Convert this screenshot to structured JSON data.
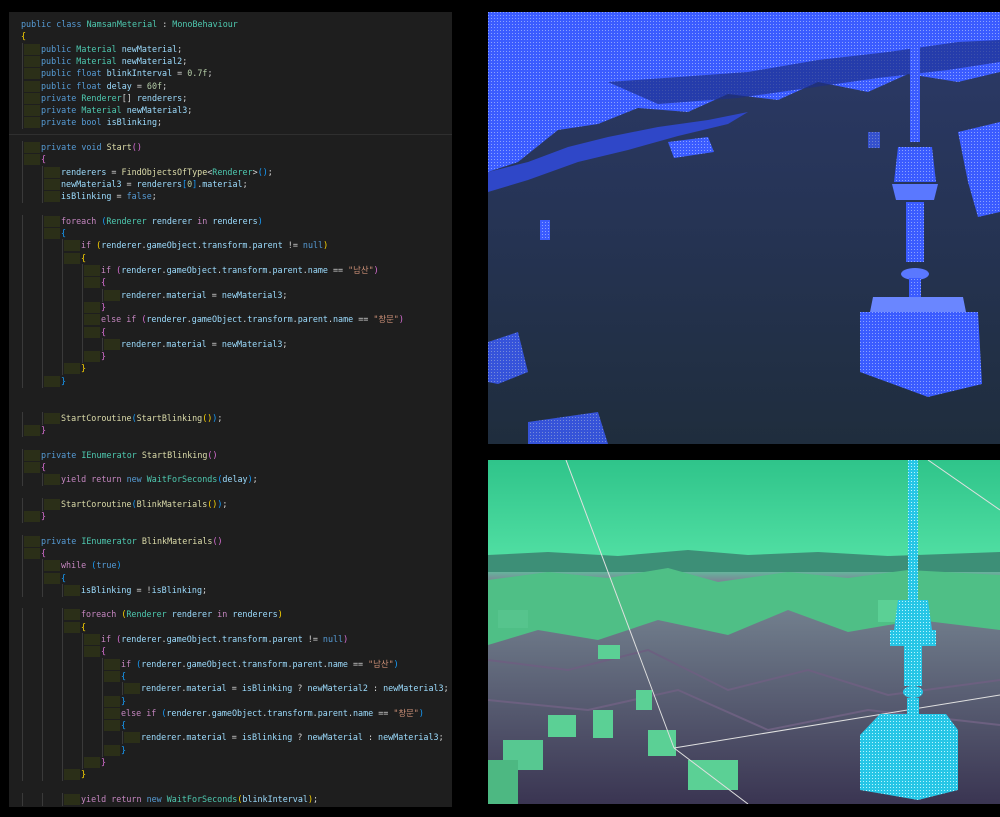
{
  "editor": {
    "lines": [
      {
        "i": 0,
        "t": [
          [
            "kw",
            "public "
          ],
          [
            "kw",
            "class "
          ],
          [
            "type",
            "NamsanMeterial"
          ],
          [
            "p",
            " : "
          ],
          [
            "type",
            "MonoBehaviour"
          ]
        ]
      },
      {
        "i": 0,
        "t": [
          [
            "br1",
            "{"
          ]
        ]
      },
      {
        "i": 1,
        "t": [
          [
            "kw",
            "public "
          ],
          [
            "type",
            "Material "
          ],
          [
            "var",
            "newMaterial"
          ],
          [
            "p",
            ";"
          ]
        ]
      },
      {
        "i": 1,
        "t": [
          [
            "kw",
            "public "
          ],
          [
            "type",
            "Material "
          ],
          [
            "var",
            "newMaterial2"
          ],
          [
            "p",
            ";"
          ]
        ]
      },
      {
        "i": 1,
        "t": [
          [
            "kw",
            "public "
          ],
          [
            "kw",
            "float "
          ],
          [
            "var",
            "blinkInterval"
          ],
          [
            "p",
            " = "
          ],
          [
            "num",
            "0.7f"
          ],
          [
            "p",
            ";"
          ]
        ]
      },
      {
        "i": 1,
        "t": [
          [
            "kw",
            "public "
          ],
          [
            "kw",
            "float "
          ],
          [
            "var",
            "delay"
          ],
          [
            "p",
            " = "
          ],
          [
            "num",
            "60f"
          ],
          [
            "p",
            ";"
          ]
        ]
      },
      {
        "i": 1,
        "t": [
          [
            "kw",
            "private "
          ],
          [
            "type",
            "Renderer"
          ],
          [
            "p",
            "[] "
          ],
          [
            "var",
            "renderers"
          ],
          [
            "p",
            ";"
          ]
        ]
      },
      {
        "i": 1,
        "t": [
          [
            "kw",
            "private "
          ],
          [
            "type",
            "Material "
          ],
          [
            "var",
            "newMaterial3"
          ],
          [
            "p",
            ";"
          ]
        ]
      },
      {
        "i": 1,
        "t": [
          [
            "kw",
            "private "
          ],
          [
            "kw",
            "bool "
          ],
          [
            "var",
            "isBlinking"
          ],
          [
            "p",
            ";"
          ]
        ]
      },
      {
        "i": 0,
        "t": []
      },
      {
        "i": 1,
        "t": [
          [
            "kw",
            "private "
          ],
          [
            "kw",
            "void "
          ],
          [
            "fn",
            "Start"
          ],
          [
            "br2",
            "()"
          ]
        ]
      },
      {
        "i": 1,
        "t": [
          [
            "br2",
            "{"
          ]
        ]
      },
      {
        "i": 2,
        "t": [
          [
            "var",
            "renderers"
          ],
          [
            "p",
            " = "
          ],
          [
            "fn",
            "FindObjectsOfType"
          ],
          [
            "p",
            "<"
          ],
          [
            "type",
            "Renderer"
          ],
          [
            "p",
            ">"
          ],
          [
            "br3",
            "()"
          ],
          [
            "p",
            ";"
          ]
        ]
      },
      {
        "i": 2,
        "t": [
          [
            "var",
            "newMaterial3"
          ],
          [
            "p",
            " = "
          ],
          [
            "var",
            "renderers"
          ],
          [
            "br3",
            "["
          ],
          [
            "num",
            "0"
          ],
          [
            "br3",
            "]"
          ],
          [
            "p",
            "."
          ],
          [
            "var",
            "material"
          ],
          [
            "p",
            ";"
          ]
        ]
      },
      {
        "i": 2,
        "t": [
          [
            "var",
            "isBlinking"
          ],
          [
            "p",
            " = "
          ],
          [
            "kw",
            "false"
          ],
          [
            "p",
            ";"
          ]
        ]
      },
      {
        "i": 0,
        "t": []
      },
      {
        "i": 2,
        "t": [
          [
            "ctl",
            "foreach "
          ],
          [
            "br3",
            "("
          ],
          [
            "type",
            "Renderer "
          ],
          [
            "var",
            "renderer "
          ],
          [
            "ctl",
            "in "
          ],
          [
            "var",
            "renderers"
          ],
          [
            "br3",
            ")"
          ]
        ]
      },
      {
        "i": 2,
        "t": [
          [
            "br3",
            "{"
          ]
        ]
      },
      {
        "i": 3,
        "t": [
          [
            "ctl",
            "if "
          ],
          [
            "br1",
            "("
          ],
          [
            "var",
            "renderer"
          ],
          [
            "p",
            "."
          ],
          [
            "var",
            "gameObject"
          ],
          [
            "p",
            "."
          ],
          [
            "var",
            "transform"
          ],
          [
            "p",
            "."
          ],
          [
            "var",
            "parent"
          ],
          [
            "p",
            " != "
          ],
          [
            "kw",
            "null"
          ],
          [
            "br1",
            ")"
          ]
        ]
      },
      {
        "i": 3,
        "t": [
          [
            "br1",
            "{"
          ]
        ]
      },
      {
        "i": 4,
        "t": [
          [
            "ctl",
            "if "
          ],
          [
            "br2",
            "("
          ],
          [
            "var",
            "renderer"
          ],
          [
            "p",
            "."
          ],
          [
            "var",
            "gameObject"
          ],
          [
            "p",
            "."
          ],
          [
            "var",
            "transform"
          ],
          [
            "p",
            "."
          ],
          [
            "var",
            "parent"
          ],
          [
            "p",
            "."
          ],
          [
            "var",
            "name"
          ],
          [
            "p",
            " == "
          ],
          [
            "str",
            "\"남산\""
          ],
          [
            "br2",
            ")"
          ]
        ]
      },
      {
        "i": 4,
        "t": [
          [
            "br2",
            "{"
          ]
        ]
      },
      {
        "i": 5,
        "t": [
          [
            "var",
            "renderer"
          ],
          [
            "p",
            "."
          ],
          [
            "var",
            "material"
          ],
          [
            "p",
            " = "
          ],
          [
            "var",
            "newMaterial3"
          ],
          [
            "p",
            ";"
          ]
        ]
      },
      {
        "i": 4,
        "t": [
          [
            "br2",
            "}"
          ]
        ]
      },
      {
        "i": 4,
        "t": [
          [
            "ctl",
            "else if "
          ],
          [
            "br2",
            "("
          ],
          [
            "var",
            "renderer"
          ],
          [
            "p",
            "."
          ],
          [
            "var",
            "gameObject"
          ],
          [
            "p",
            "."
          ],
          [
            "var",
            "transform"
          ],
          [
            "p",
            "."
          ],
          [
            "var",
            "parent"
          ],
          [
            "p",
            "."
          ],
          [
            "var",
            "name"
          ],
          [
            "p",
            " == "
          ],
          [
            "str",
            "\"창문\""
          ],
          [
            "br2",
            ")"
          ]
        ]
      },
      {
        "i": 4,
        "t": [
          [
            "br2",
            "{"
          ]
        ]
      },
      {
        "i": 5,
        "t": [
          [
            "var",
            "renderer"
          ],
          [
            "p",
            "."
          ],
          [
            "var",
            "material"
          ],
          [
            "p",
            " = "
          ],
          [
            "var",
            "newMaterial3"
          ],
          [
            "p",
            ";"
          ]
        ]
      },
      {
        "i": 4,
        "t": [
          [
            "br2",
            "}"
          ]
        ]
      },
      {
        "i": 3,
        "t": [
          [
            "br1",
            "}"
          ]
        ]
      },
      {
        "i": 2,
        "t": [
          [
            "br3",
            "}"
          ]
        ]
      },
      {
        "i": 0,
        "t": []
      },
      {
        "i": 0,
        "t": []
      },
      {
        "i": 2,
        "t": [
          [
            "fn",
            "StartCoroutine"
          ],
          [
            "br3",
            "("
          ],
          [
            "fn",
            "StartBlinking"
          ],
          [
            "br1",
            "()"
          ],
          [
            "br3",
            ")"
          ],
          [
            "p",
            ";"
          ]
        ]
      },
      {
        "i": 1,
        "t": [
          [
            "br2",
            "}"
          ]
        ]
      },
      {
        "i": 0,
        "t": []
      },
      {
        "i": 1,
        "t": [
          [
            "kw",
            "private "
          ],
          [
            "type",
            "IEnumerator "
          ],
          [
            "fn",
            "StartBlinking"
          ],
          [
            "br2",
            "()"
          ]
        ]
      },
      {
        "i": 1,
        "t": [
          [
            "br2",
            "{"
          ]
        ]
      },
      {
        "i": 2,
        "t": [
          [
            "ctl",
            "yield return "
          ],
          [
            "kw",
            "new "
          ],
          [
            "type",
            "WaitForSeconds"
          ],
          [
            "br3",
            "("
          ],
          [
            "var",
            "delay"
          ],
          [
            "br3",
            ")"
          ],
          [
            "p",
            ";"
          ]
        ]
      },
      {
        "i": 0,
        "t": []
      },
      {
        "i": 2,
        "t": [
          [
            "fn",
            "StartCoroutine"
          ],
          [
            "br3",
            "("
          ],
          [
            "fn",
            "BlinkMaterials"
          ],
          [
            "br1",
            "()"
          ],
          [
            "br3",
            ")"
          ],
          [
            "p",
            ";"
          ]
        ]
      },
      {
        "i": 1,
        "t": [
          [
            "br2",
            "}"
          ]
        ]
      },
      {
        "i": 0,
        "t": []
      },
      {
        "i": 1,
        "t": [
          [
            "kw",
            "private "
          ],
          [
            "type",
            "IEnumerator "
          ],
          [
            "fn",
            "BlinkMaterials"
          ],
          [
            "br2",
            "()"
          ]
        ]
      },
      {
        "i": 1,
        "t": [
          [
            "br2",
            "{"
          ]
        ]
      },
      {
        "i": 2,
        "t": [
          [
            "ctl",
            "while "
          ],
          [
            "br3",
            "("
          ],
          [
            "kw",
            "true"
          ],
          [
            "br3",
            ")"
          ]
        ]
      },
      {
        "i": 2,
        "t": [
          [
            "br3",
            "{"
          ]
        ]
      },
      {
        "i": 3,
        "t": [
          [
            "var",
            "isBlinking"
          ],
          [
            "p",
            " = !"
          ],
          [
            "var",
            "isBlinking"
          ],
          [
            "p",
            ";"
          ]
        ]
      },
      {
        "i": 0,
        "t": []
      },
      {
        "i": 3,
        "t": [
          [
            "ctl",
            "foreach "
          ],
          [
            "br1",
            "("
          ],
          [
            "type",
            "Renderer "
          ],
          [
            "var",
            "renderer "
          ],
          [
            "ctl",
            "in "
          ],
          [
            "var",
            "renderers"
          ],
          [
            "br1",
            ")"
          ]
        ]
      },
      {
        "i": 3,
        "t": [
          [
            "br1",
            "{"
          ]
        ]
      },
      {
        "i": 4,
        "t": [
          [
            "ctl",
            "if "
          ],
          [
            "br2",
            "("
          ],
          [
            "var",
            "renderer"
          ],
          [
            "p",
            "."
          ],
          [
            "var",
            "gameObject"
          ],
          [
            "p",
            "."
          ],
          [
            "var",
            "transform"
          ],
          [
            "p",
            "."
          ],
          [
            "var",
            "parent"
          ],
          [
            "p",
            " != "
          ],
          [
            "kw",
            "null"
          ],
          [
            "br2",
            ")"
          ]
        ]
      },
      {
        "i": 4,
        "t": [
          [
            "br2",
            "{"
          ]
        ]
      },
      {
        "i": 5,
        "t": [
          [
            "ctl",
            "if "
          ],
          [
            "br3",
            "("
          ],
          [
            "var",
            "renderer"
          ],
          [
            "p",
            "."
          ],
          [
            "var",
            "gameObject"
          ],
          [
            "p",
            "."
          ],
          [
            "var",
            "transform"
          ],
          [
            "p",
            "."
          ],
          [
            "var",
            "parent"
          ],
          [
            "p",
            "."
          ],
          [
            "var",
            "name"
          ],
          [
            "p",
            " == "
          ],
          [
            "str",
            "\"남산\""
          ],
          [
            "br3",
            ")"
          ]
        ]
      },
      {
        "i": 5,
        "t": [
          [
            "br3",
            "{"
          ]
        ]
      },
      {
        "i": 6,
        "t": [
          [
            "var",
            "renderer"
          ],
          [
            "p",
            "."
          ],
          [
            "var",
            "material"
          ],
          [
            "p",
            " = "
          ],
          [
            "var",
            "isBlinking"
          ],
          [
            "p",
            " ? "
          ],
          [
            "var",
            "newMaterial2"
          ],
          [
            "p",
            " : "
          ],
          [
            "var",
            "newMaterial3"
          ],
          [
            "p",
            ";"
          ]
        ]
      },
      {
        "i": 5,
        "t": [
          [
            "br3",
            "}"
          ]
        ]
      },
      {
        "i": 5,
        "t": [
          [
            "ctl",
            "else if "
          ],
          [
            "br3",
            "("
          ],
          [
            "var",
            "renderer"
          ],
          [
            "p",
            "."
          ],
          [
            "var",
            "gameObject"
          ],
          [
            "p",
            "."
          ],
          [
            "var",
            "transform"
          ],
          [
            "p",
            "."
          ],
          [
            "var",
            "parent"
          ],
          [
            "p",
            "."
          ],
          [
            "var",
            "name"
          ],
          [
            "p",
            " == "
          ],
          [
            "str",
            "\"창문\""
          ],
          [
            "br3",
            ")"
          ]
        ]
      },
      {
        "i": 5,
        "t": [
          [
            "br3",
            "{"
          ]
        ]
      },
      {
        "i": 6,
        "t": [
          [
            "var",
            "renderer"
          ],
          [
            "p",
            "."
          ],
          [
            "var",
            "material"
          ],
          [
            "p",
            " = "
          ],
          [
            "var",
            "isBlinking"
          ],
          [
            "p",
            " ? "
          ],
          [
            "var",
            "newMaterial"
          ],
          [
            "p",
            " : "
          ],
          [
            "var",
            "newMaterial3"
          ],
          [
            "p",
            ";"
          ]
        ]
      },
      {
        "i": 5,
        "t": [
          [
            "br3",
            "}"
          ]
        ]
      },
      {
        "i": 4,
        "t": [
          [
            "br2",
            "}"
          ]
        ]
      },
      {
        "i": 3,
        "t": [
          [
            "br1",
            "}"
          ]
        ]
      },
      {
        "i": 0,
        "t": []
      },
      {
        "i": 3,
        "t": [
          [
            "ctl",
            "yield return "
          ],
          [
            "kw",
            "new "
          ],
          [
            "type",
            "WaitForSeconds"
          ],
          [
            "br1",
            "("
          ],
          [
            "var",
            "blinkInterval"
          ],
          [
            "br1",
            ")"
          ],
          [
            "p",
            ";"
          ]
        ]
      }
    ]
  },
  "viewports": {
    "top": {
      "tint": "#3a5cff",
      "background": "#263544"
    },
    "bottom": {
      "tint": "#5fe0a0",
      "tower": "#33e6ff",
      "background": "#3a3550"
    }
  }
}
